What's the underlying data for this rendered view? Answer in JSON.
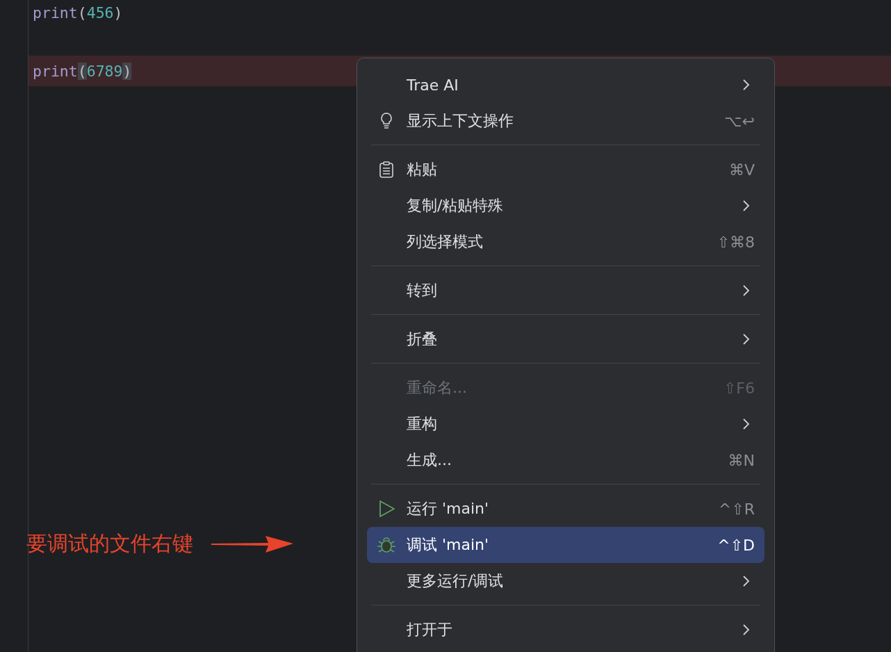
{
  "editor": {
    "lines": [
      {
        "tokens": [
          {
            "kind": "name",
            "text": "print"
          },
          {
            "kind": "paren",
            "text": "(",
            "matched": false
          },
          {
            "kind": "number",
            "text": "456"
          },
          {
            "kind": "paren",
            "text": ")",
            "matched": false
          }
        ],
        "highlighted": false
      },
      {
        "highlighted": false
      },
      {
        "tokens": [
          {
            "kind": "name",
            "text": "print"
          },
          {
            "kind": "paren",
            "text": "(",
            "matched": true
          },
          {
            "kind": "number",
            "text": "6789"
          },
          {
            "kind": "paren",
            "text": ")",
            "matched": true
          }
        ],
        "highlighted": true
      }
    ]
  },
  "context_menu": {
    "items": [
      {
        "kind": "plain",
        "label": "Trae AI",
        "submenu": true,
        "disabled": false,
        "selected": false
      },
      {
        "kind": "hint",
        "label": "显示上下文操作",
        "shortcut": "⌥↩",
        "submenu": false,
        "disabled": false,
        "selected": false
      },
      {
        "kind": "separator"
      },
      {
        "kind": "paste",
        "label": "粘贴",
        "shortcut": "⌘V",
        "submenu": false,
        "disabled": false,
        "selected": false
      },
      {
        "kind": "plain",
        "label": "复制/粘贴特殊",
        "submenu": true,
        "disabled": false,
        "selected": false
      },
      {
        "kind": "plain",
        "label": "列选择模式",
        "shortcut": "⇧⌘8",
        "submenu": false,
        "disabled": false,
        "selected": false
      },
      {
        "kind": "separator"
      },
      {
        "kind": "plain",
        "label": "转到",
        "submenu": true,
        "disabled": false,
        "selected": false
      },
      {
        "kind": "separator"
      },
      {
        "kind": "plain",
        "label": "折叠",
        "submenu": true,
        "disabled": false,
        "selected": false
      },
      {
        "kind": "separator"
      },
      {
        "kind": "plain",
        "label": "重命名...",
        "shortcut": "⇧F6",
        "submenu": false,
        "disabled": true,
        "selected": false
      },
      {
        "kind": "plain",
        "label": "重构",
        "submenu": true,
        "disabled": false,
        "selected": false
      },
      {
        "kind": "plain",
        "label": "生成...",
        "shortcut": "⌘N",
        "submenu": false,
        "disabled": false,
        "selected": false
      },
      {
        "kind": "separator"
      },
      {
        "kind": "run",
        "label": "运行 'main'",
        "shortcut": "^⇧R",
        "submenu": false,
        "disabled": false,
        "selected": false
      },
      {
        "kind": "debug",
        "label": "调试 'main'",
        "shortcut": "^⇧D",
        "submenu": false,
        "disabled": false,
        "selected": true
      },
      {
        "kind": "plain",
        "label": "更多运行/调试",
        "submenu": true,
        "disabled": false,
        "selected": false
      },
      {
        "kind": "separator"
      },
      {
        "kind": "plain",
        "label": "打开于",
        "submenu": true,
        "disabled": false,
        "selected": false
      }
    ]
  },
  "annotation": {
    "text": "要调试的文件右键"
  }
}
